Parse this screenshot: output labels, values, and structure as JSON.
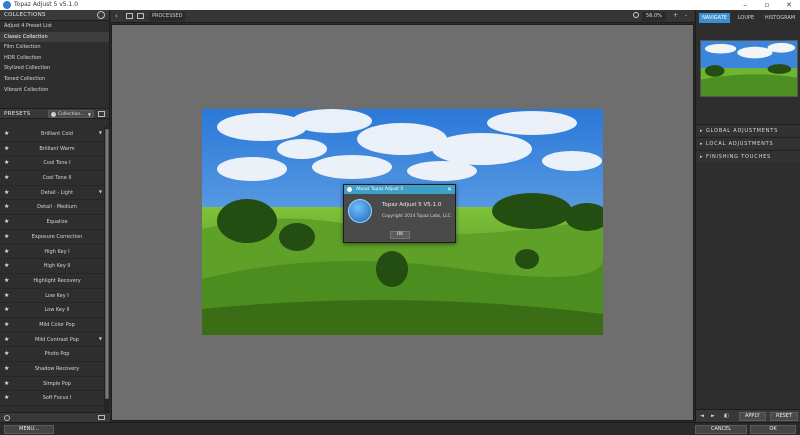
{
  "window": {
    "title": "Topaz Adjust 5 v5.1.0"
  },
  "collections": {
    "header": "COLLECTIONS",
    "items": [
      "Adjust 4 Preset List",
      "Classic Collection",
      "Film Collection",
      "HDR Collection",
      "Stylized Collection",
      "Toned Collection",
      "Vibrant Collection"
    ],
    "selected_index": 1
  },
  "presets": {
    "header": "PRESETS",
    "filter_value": "Collection...",
    "items": [
      {
        "name": "Brilliant Cold",
        "has_submenu": true
      },
      {
        "name": "Brilliant Warm",
        "has_submenu": false
      },
      {
        "name": "Cool Tone I",
        "has_submenu": false
      },
      {
        "name": "Cool Tone II",
        "has_submenu": false
      },
      {
        "name": "Detail - Light",
        "has_submenu": true
      },
      {
        "name": "Detail - Medium",
        "has_submenu": false
      },
      {
        "name": "Equalize",
        "has_submenu": false
      },
      {
        "name": "Exposure Correction",
        "has_submenu": false
      },
      {
        "name": "High Key I",
        "has_submenu": false
      },
      {
        "name": "High Key II",
        "has_submenu": false
      },
      {
        "name": "Highlight Recovery",
        "has_submenu": false
      },
      {
        "name": "Low Key I",
        "has_submenu": false
      },
      {
        "name": "Low Key II",
        "has_submenu": false
      },
      {
        "name": "Mild Color Pop",
        "has_submenu": false
      },
      {
        "name": "Mild Contrast Pop",
        "has_submenu": true
      },
      {
        "name": "Photo Pop",
        "has_submenu": false
      },
      {
        "name": "Shadow Recovery",
        "has_submenu": false
      },
      {
        "name": "Simple Pop",
        "has_submenu": false
      },
      {
        "name": "Soft Focus I",
        "has_submenu": false
      }
    ]
  },
  "toolbar": {
    "view_label": "PROCESSED",
    "zoom_value": "56.0%",
    "zoom_in": "+",
    "zoom_out": "-"
  },
  "dialog": {
    "title": "About Topaz Adjust 5",
    "product": "Topaz Adjust 5 V5.1.0",
    "copyright": "Copyright 2014 Topaz Labs, LLC.",
    "ok_label": "OK"
  },
  "right": {
    "tabs": [
      "NAVIGATE",
      "LOUPE",
      "HISTOGRAM"
    ],
    "active_tab": 0,
    "adjustments": [
      "GLOBAL ADJUSTMENTS",
      "LOCAL ADJUSTMENTS",
      "FINISHING TOUCHES"
    ],
    "apply_label": "APPLY",
    "reset_label": "RESET"
  },
  "bottom": {
    "menu_label": "MENU...",
    "cancel_label": "CANCEL",
    "ok_label": "OK"
  },
  "colors": {
    "accent": "#3b8fd1",
    "dialog_header": "#3da0c9",
    "canvas_bg": "#6e6e6e"
  }
}
